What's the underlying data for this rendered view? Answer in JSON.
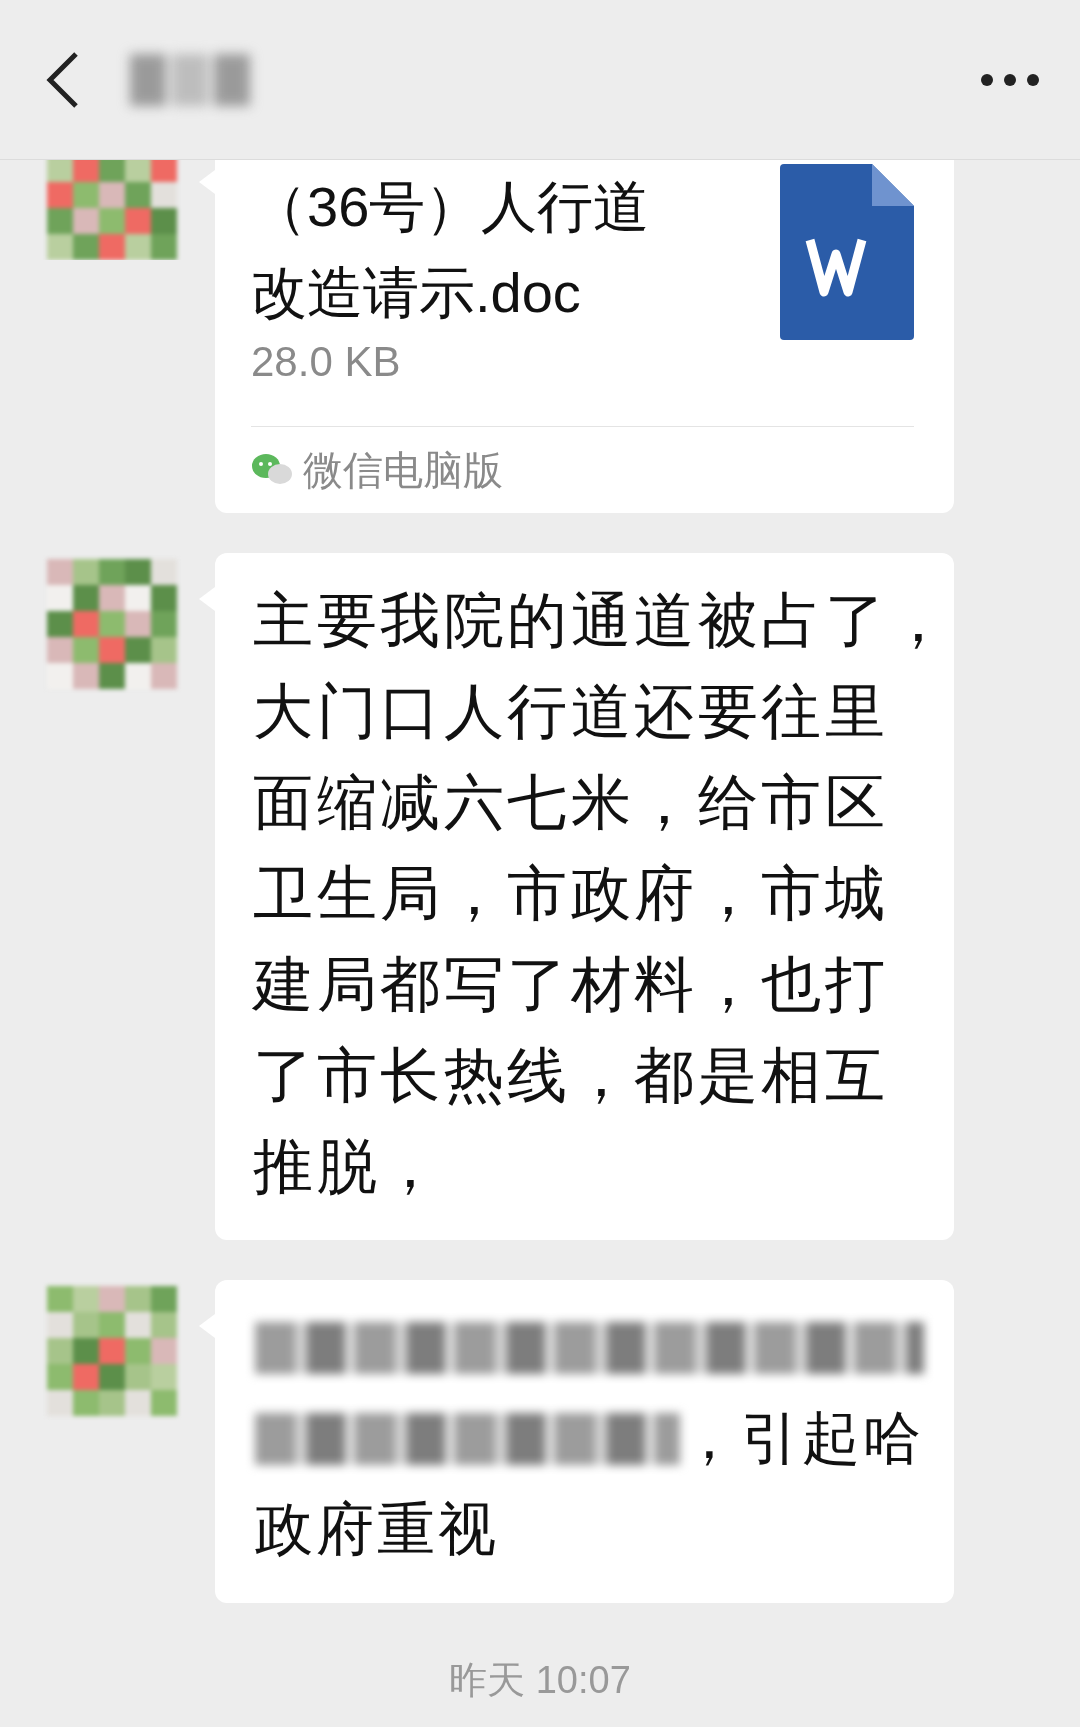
{
  "header": {
    "title_blurred": true
  },
  "messages": [
    {
      "kind": "file",
      "name_lines": [
        "（36号）人行道",
        "改造请示.doc"
      ],
      "size": "28.0 KB",
      "source": "微信电脑版",
      "cut_top": true
    },
    {
      "kind": "text",
      "lines": [
        "主要我院的通道被占了，",
        "大门口人行道还要往里",
        "面缩减六七米，给市区",
        "卫生局，市政府，市城",
        "建局都写了材料，也打",
        "了市长热线，都是相互",
        "推脱，"
      ]
    },
    {
      "kind": "partly_blurred",
      "lines": [
        {
          "blurred": true
        },
        {
          "blurred": true,
          "text": "，引起哈"
        },
        {
          "text": "政府重视"
        }
      ]
    }
  ],
  "timestamp": "昨天 10:07"
}
